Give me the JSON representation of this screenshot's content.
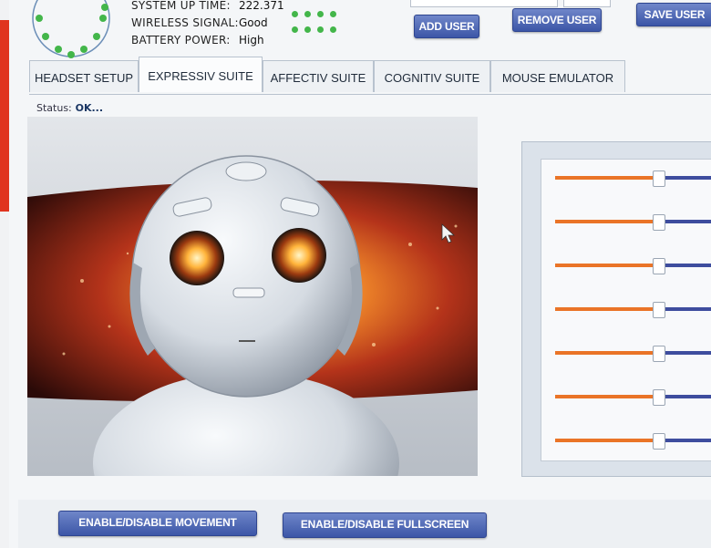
{
  "info": {
    "rows": [
      {
        "label": "SYSTEM UP TIME:",
        "value": "222.371"
      },
      {
        "label": "WIRELESS SIGNAL:",
        "value": "Good"
      },
      {
        "label": "BATTERY POWER:",
        "value": "High"
      }
    ]
  },
  "user_buttons": {
    "add": "ADD USER",
    "remove": "REMOVE USER",
    "save": "SAVE USER"
  },
  "tabs": [
    {
      "label": "HEADSET SETUP",
      "active": false
    },
    {
      "label": "EXPRESSIV SUITE",
      "active": true
    },
    {
      "label": "AFFECTIV SUITE",
      "active": false
    },
    {
      "label": "COGNITIV SUITE",
      "active": false
    },
    {
      "label": "MOUSE EMULATOR",
      "active": false
    }
  ],
  "status": {
    "label": "Status:",
    "value": "OK..."
  },
  "sliders": [
    {
      "value": 0.62
    },
    {
      "value": 0.62
    },
    {
      "value": 0.62
    },
    {
      "value": 0.62
    },
    {
      "value": 0.62
    },
    {
      "value": 0.62
    },
    {
      "value": 0.62
    }
  ],
  "bottom_buttons": {
    "movement": "ENABLE/DISABLE MOVEMENT",
    "fullscreen": "ENABLE/DISABLE FULLSCREEN"
  },
  "colors": {
    "button_blue": "#4a62b3",
    "slider_orange": "#ea7427",
    "slider_blue": "#3e4d9e",
    "signal_green": "#43b64a",
    "brand_red": "#e0341f"
  },
  "icons": [
    "headset-sensor-map-icon",
    "signal-dots-icon",
    "mouse-cursor-icon"
  ]
}
